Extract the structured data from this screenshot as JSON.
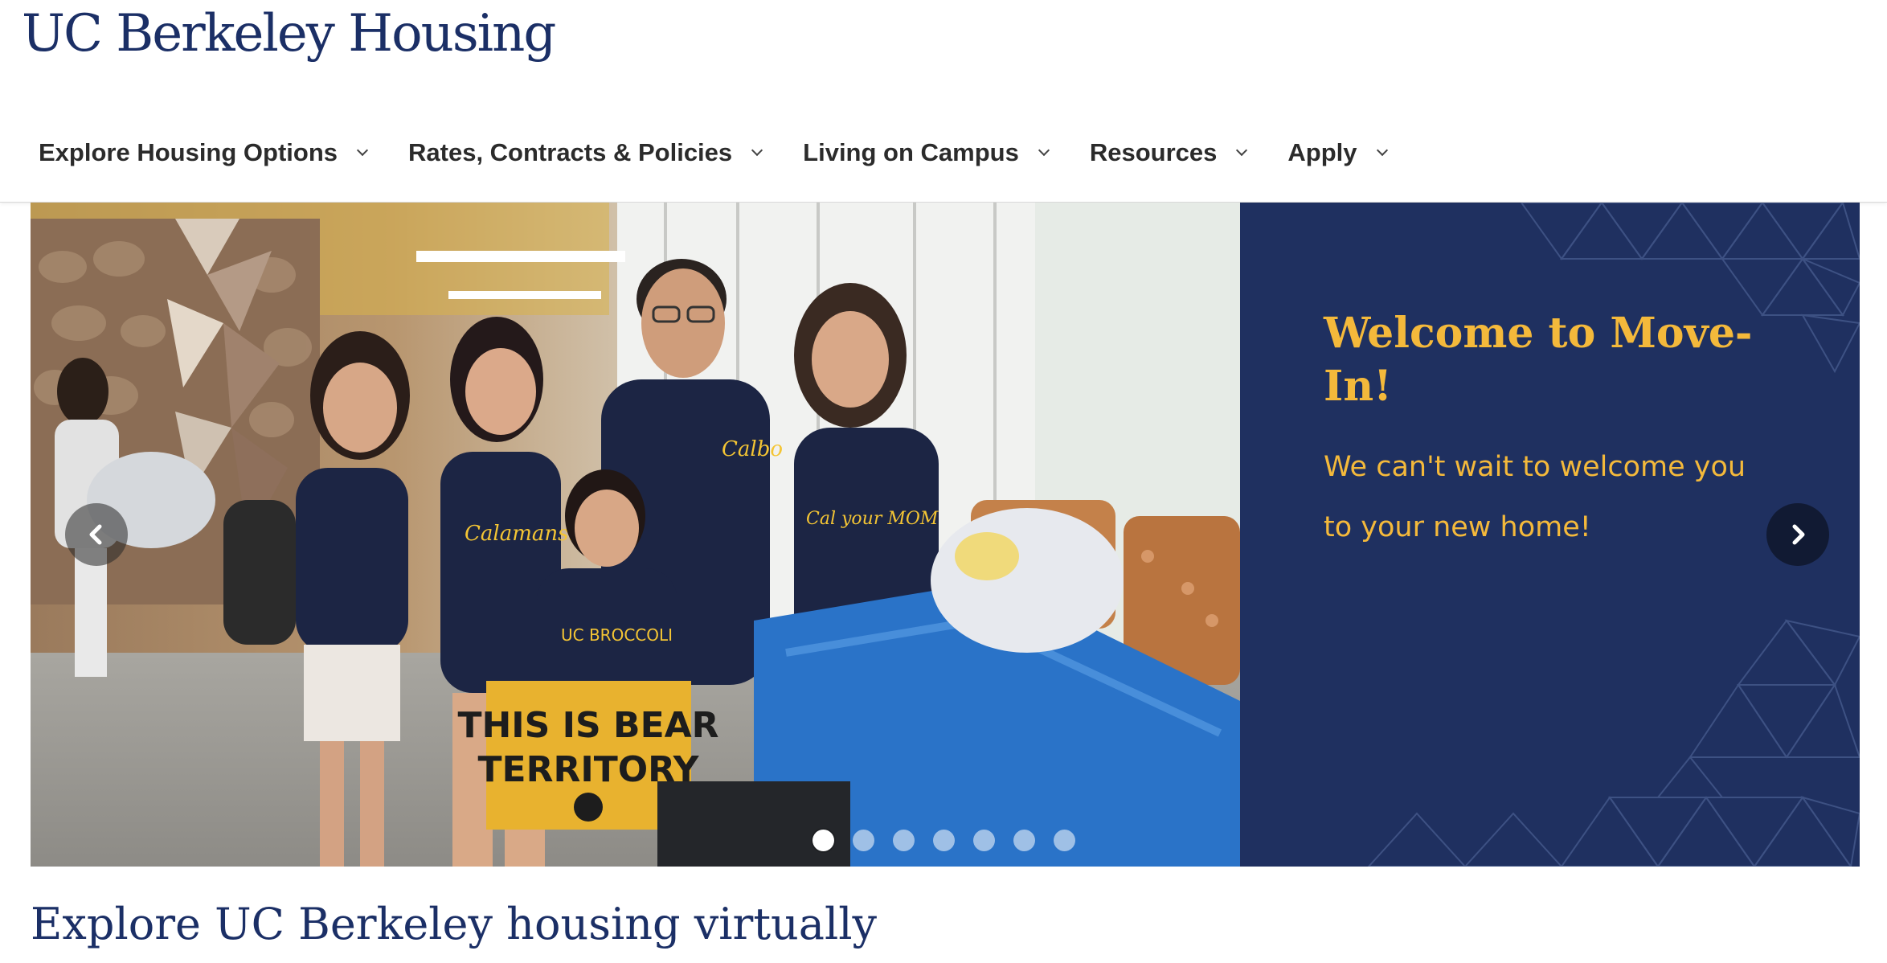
{
  "site": {
    "logo_text": "UC Berkeley Housing"
  },
  "nav": {
    "items": [
      {
        "label": "Explore Housing Options",
        "icon": "chevron-down-icon"
      },
      {
        "label": "Rates, Contracts & Policies",
        "icon": "chevron-down-icon"
      },
      {
        "label": "Living on Campus",
        "icon": "chevron-down-icon"
      },
      {
        "label": "Resources",
        "icon": "chevron-down-icon"
      },
      {
        "label": "Apply",
        "icon": "chevron-down-icon"
      }
    ]
  },
  "hero": {
    "slide_title": "Welcome to Move-In!",
    "slide_text": "We can't wait to welcome you to your new home!",
    "photo_sign": "THIS IS BEAR TERRITORY",
    "prev_icon": "chevron-left-icon",
    "next_icon": "chevron-right-icon",
    "slide_count": 7,
    "active_slide": 1,
    "colors": {
      "panel": "#1f3060",
      "accent": "#f4b93b"
    }
  },
  "section": {
    "heading": "Explore UC Berkeley housing virtually"
  },
  "colors": {
    "brand_navy": "#1b2f66",
    "nav_text": "#2b2b2b"
  }
}
